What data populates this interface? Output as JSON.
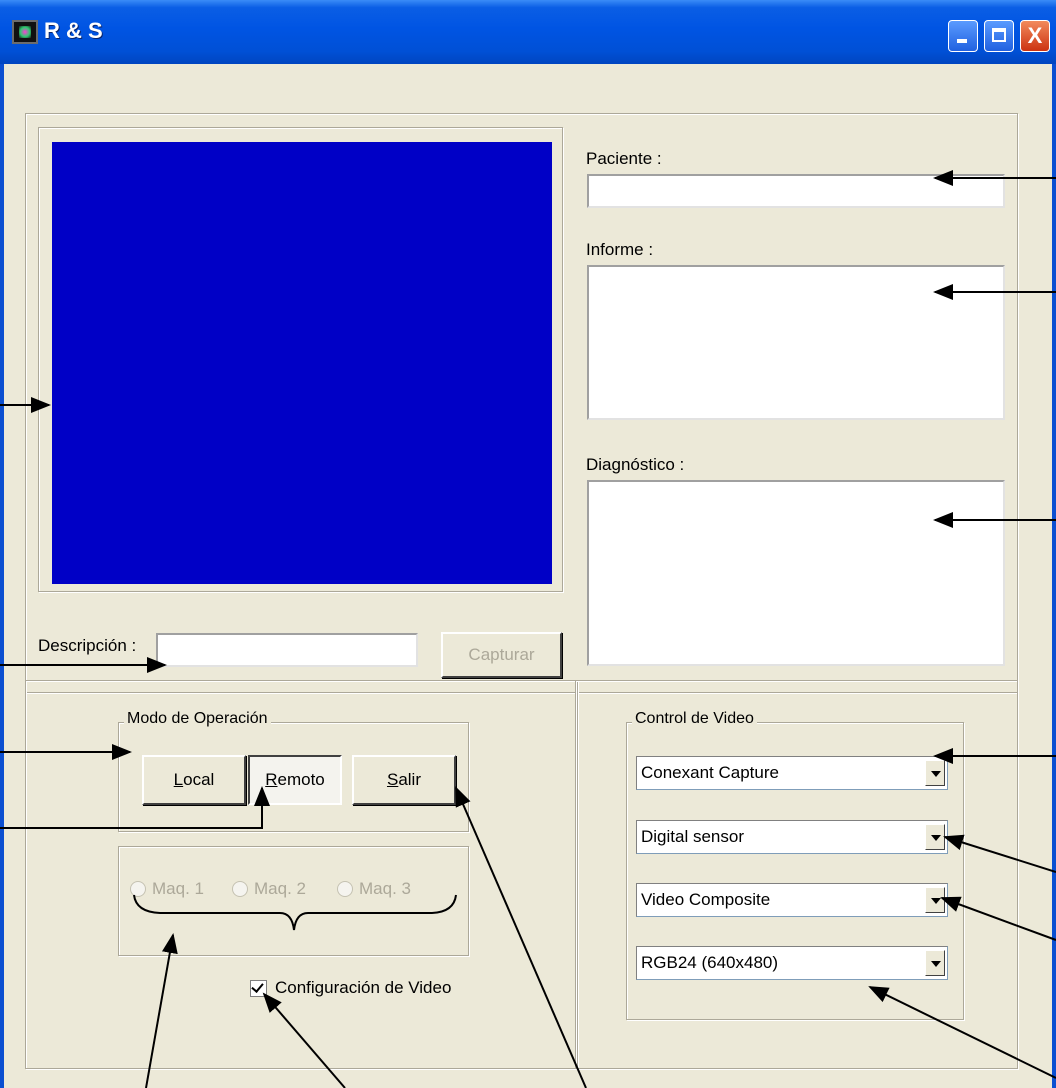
{
  "window": {
    "title": "R & S",
    "controls": {
      "minimize": "_",
      "maximize": "□",
      "close": "X"
    }
  },
  "preview": {
    "bg_color": "#0000c6"
  },
  "descripcion": {
    "label": "Descripción :",
    "value": ""
  },
  "capture_button": {
    "label": "Capturar",
    "enabled": false
  },
  "paciente": {
    "label": "Paciente :",
    "value": ""
  },
  "informe": {
    "label": "Informe :",
    "value": ""
  },
  "diagnostico": {
    "label": "Diagnóstico :",
    "value": ""
  },
  "modo": {
    "title": "Modo de Operación",
    "buttons": [
      {
        "label": "Local",
        "accel": "L",
        "rest": "ocal",
        "pressed": false
      },
      {
        "label": "Remoto",
        "accel": "R",
        "rest": "emoto",
        "pressed": true
      },
      {
        "label": "Salir",
        "accel": "S",
        "rest": "alir",
        "pressed": false
      }
    ]
  },
  "maquinas": {
    "options": [
      "Maq. 1",
      "Maq. 2",
      "Maq. 3"
    ],
    "enabled": false
  },
  "config_video": {
    "label": "Configuración de Video",
    "checked": true
  },
  "video_control": {
    "title": "Control de Video",
    "combos": [
      {
        "value": "Conexant Capture"
      },
      {
        "value": "Digital sensor"
      },
      {
        "value": "Video Composite"
      },
      {
        "value": "RGB24 (640x480)"
      }
    ]
  },
  "colors": {
    "titlebar": "#0054e3",
    "background": "#ece9d8",
    "preview": "#0000c6"
  }
}
